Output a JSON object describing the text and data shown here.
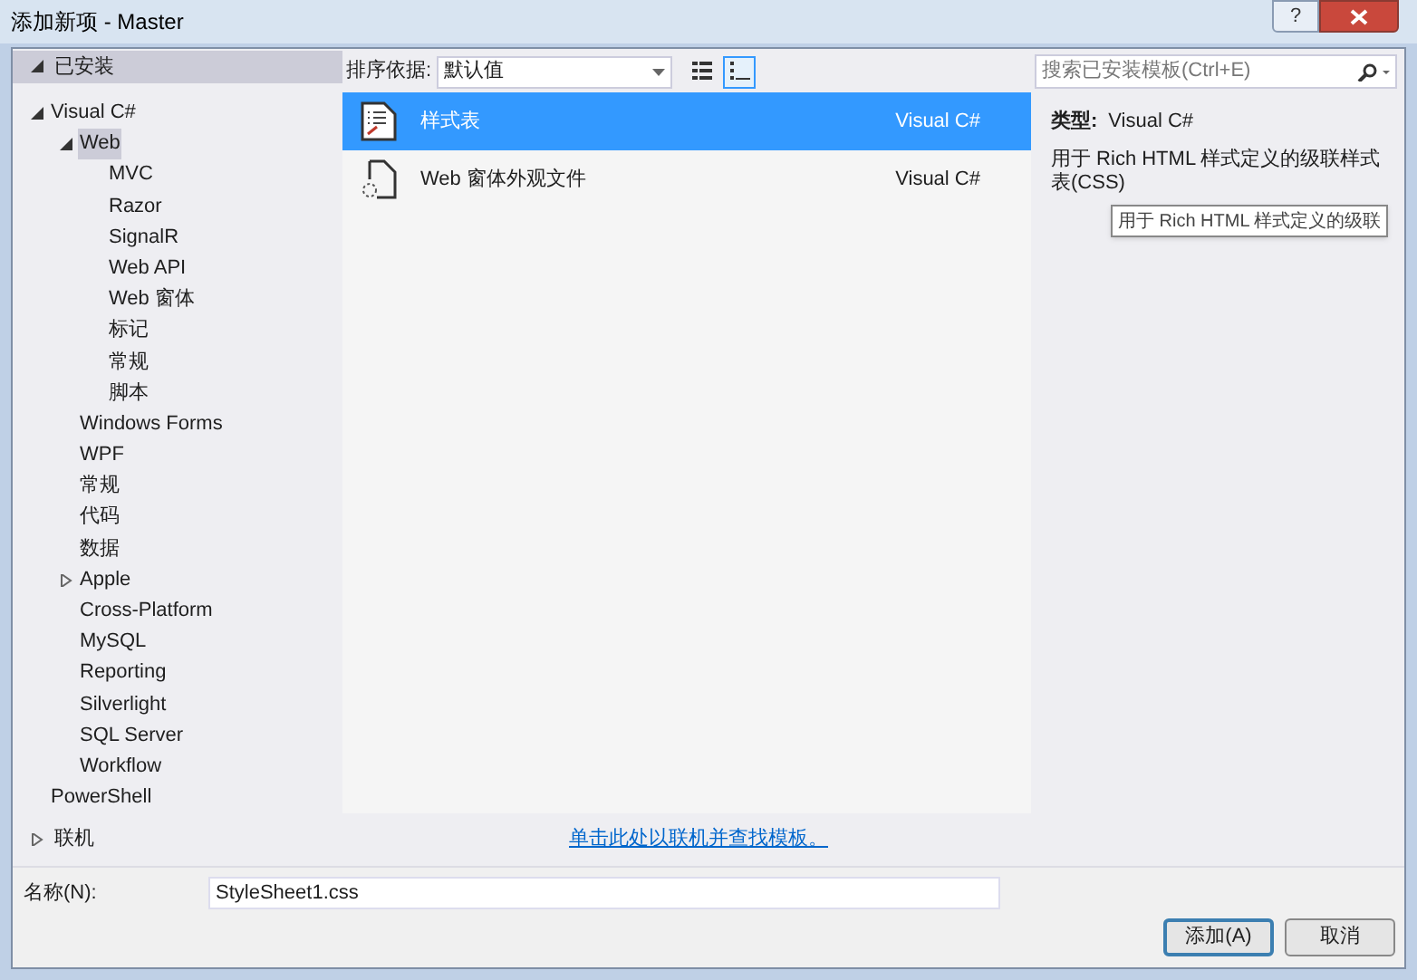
{
  "window": {
    "title": "添加新项 - Master",
    "help_button": "?"
  },
  "sidebar": {
    "installed": {
      "label": "已安装",
      "expanded": true,
      "children": [
        {
          "label": "Visual C#",
          "expanded": true,
          "selected": false,
          "children": [
            {
              "label": "Web",
              "expanded": true,
              "selected": true,
              "children": [
                {
                  "label": "MVC",
                  "selected": false
                },
                {
                  "label": "Razor",
                  "selected": false
                },
                {
                  "label": "SignalR",
                  "selected": false
                },
                {
                  "label": "Web API",
                  "selected": false
                },
                {
                  "label": "Web 窗体",
                  "selected": false
                },
                {
                  "label": "标记",
                  "selected": false
                },
                {
                  "label": "常规",
                  "selected": false
                },
                {
                  "label": "脚本",
                  "selected": false
                }
              ]
            },
            {
              "label": "Windows Forms",
              "selected": false
            },
            {
              "label": "WPF",
              "selected": false
            },
            {
              "label": "常规",
              "selected": false
            },
            {
              "label": "代码",
              "selected": false
            },
            {
              "label": "数据",
              "selected": false
            },
            {
              "label": "Apple",
              "expanded": false,
              "selected": false
            },
            {
              "label": "Cross-Platform",
              "selected": false
            },
            {
              "label": "MySQL",
              "selected": false
            },
            {
              "label": "Reporting",
              "selected": false
            },
            {
              "label": "Silverlight",
              "selected": false
            },
            {
              "label": "SQL Server",
              "selected": false
            },
            {
              "label": "Workflow",
              "selected": false
            }
          ]
        },
        {
          "label": "PowerShell",
          "selected": false
        }
      ]
    },
    "online": {
      "label": "联机",
      "expanded": false
    }
  },
  "toolbar": {
    "sort_label": "排序依据:",
    "sort_value": "默认值",
    "views": [
      {
        "kind": "details",
        "selected": false
      },
      {
        "kind": "list",
        "selected": true
      }
    ]
  },
  "search": {
    "placeholder": "搜索已安装模板(Ctrl+E)"
  },
  "templates": [
    {
      "name": "样式表",
      "language": "Visual C#",
      "selected": true,
      "kind": "stylesheet"
    },
    {
      "name": "Web 窗体外观文件",
      "language": "Visual C#",
      "selected": false,
      "kind": "skin"
    }
  ],
  "details": {
    "type_label": "类型:",
    "type_value": "Visual C#",
    "description": "用于 Rich HTML 样式定义的级联样式表(CSS)",
    "tooltip": "用于 Rich HTML 样式定义的级联"
  },
  "online_link": "单击此处以联机并查找模板。",
  "name_field": {
    "label": "名称(N):",
    "value": "StyleSheet1.css"
  },
  "buttons": [
    {
      "label": "添加(A)",
      "kind": "default"
    },
    {
      "label": "取消",
      "kind": "normal"
    }
  ]
}
